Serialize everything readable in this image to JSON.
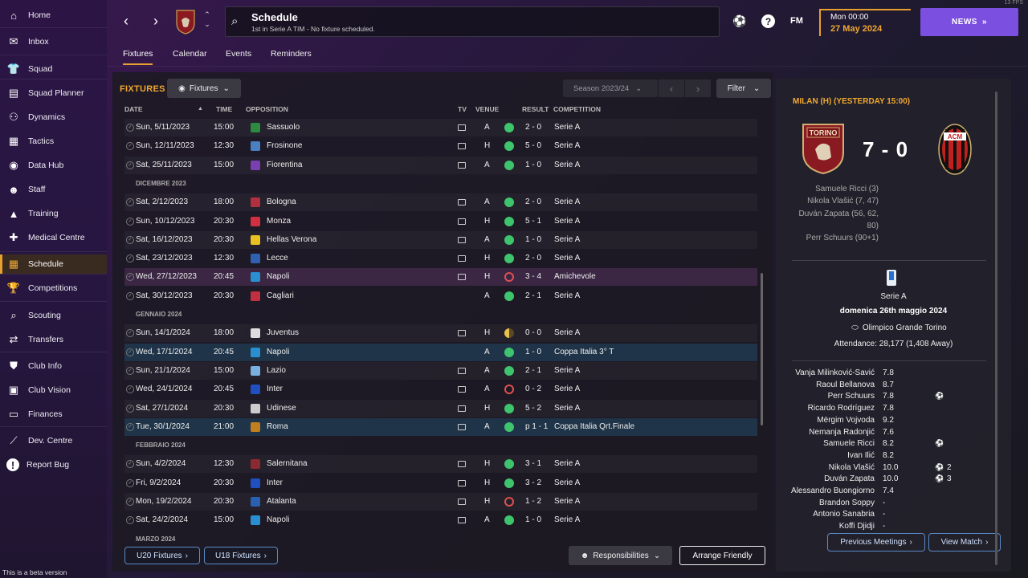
{
  "sidebar": {
    "items": [
      {
        "label": "Home",
        "icon": "home-icon",
        "glyph": "⌂"
      },
      {
        "label": "Inbox",
        "icon": "inbox-icon",
        "glyph": "✉"
      },
      {
        "label": "Squad",
        "icon": "squad-icon",
        "glyph": "👕"
      },
      {
        "label": "Squad Planner",
        "icon": "squad-planner-icon",
        "glyph": "▤"
      },
      {
        "label": "Dynamics",
        "icon": "dynamics-icon",
        "glyph": "⚇"
      },
      {
        "label": "Tactics",
        "icon": "tactics-icon",
        "glyph": "▦"
      },
      {
        "label": "Data Hub",
        "icon": "data-hub-icon",
        "glyph": "◉"
      },
      {
        "label": "Staff",
        "icon": "staff-icon",
        "glyph": "☻"
      },
      {
        "label": "Training",
        "icon": "training-icon",
        "glyph": "▲"
      },
      {
        "label": "Medical Centre",
        "icon": "medical-icon",
        "glyph": "✚"
      },
      {
        "label": "Schedule",
        "icon": "schedule-icon",
        "glyph": "▦"
      },
      {
        "label": "Competitions",
        "icon": "trophy-icon",
        "glyph": "🏆"
      },
      {
        "label": "Scouting",
        "icon": "scouting-icon",
        "glyph": "⌕"
      },
      {
        "label": "Transfers",
        "icon": "transfers-icon",
        "glyph": "⇄"
      },
      {
        "label": "Club Info",
        "icon": "club-info-icon",
        "glyph": "⛊"
      },
      {
        "label": "Club Vision",
        "icon": "club-vision-icon",
        "glyph": "▣"
      },
      {
        "label": "Finances",
        "icon": "finances-icon",
        "glyph": "▭"
      },
      {
        "label": "Dev. Centre",
        "icon": "dev-centre-icon",
        "glyph": "⟋"
      },
      {
        "label": "Report Bug",
        "icon": "report-bug-icon",
        "glyph": "!"
      }
    ],
    "beta_text": "This is a beta version"
  },
  "header": {
    "title": "Schedule",
    "subtitle": "1st in Serie A TIM - No fixture scheduled.",
    "fm_label": "FM",
    "date_time": "Mon 00:00",
    "date": "27 May 2024",
    "news_label": "NEWS",
    "fps": "13 FPS"
  },
  "tabs": [
    "Fixtures",
    "Calendar",
    "Events",
    "Reminders"
  ],
  "fixtures": {
    "title": "FIXTURES",
    "view_label": "Fixtures",
    "season_label": "Season 2023/24",
    "filter_label": "Filter",
    "columns": {
      "date": "DATE",
      "time": "TIME",
      "opposition": "OPPOSITION",
      "tv": "TV",
      "venue": "VENUE",
      "result": "RESULT",
      "competition": "COMPETITION"
    },
    "rows": [
      {
        "date": "Sun, 5/11/2023",
        "time": "15:00",
        "opp": "Sassuolo",
        "tv": true,
        "venue": "A",
        "res": "W",
        "score": "2 - 0",
        "comp": "Serie A",
        "c": "#2e8a3e"
      },
      {
        "date": "Sun, 12/11/2023",
        "time": "12:30",
        "opp": "Frosinone",
        "tv": true,
        "venue": "H",
        "res": "W",
        "score": "5 - 0",
        "comp": "Serie A",
        "c": "#4a7fc0"
      },
      {
        "date": "Sat, 25/11/2023",
        "time": "15:00",
        "opp": "Fiorentina",
        "tv": true,
        "venue": "A",
        "res": "W",
        "score": "1 - 0",
        "comp": "Serie A",
        "c": "#7a3fb0"
      },
      {
        "month": "DICEMBRE 2023"
      },
      {
        "date": "Sat, 2/12/2023",
        "time": "18:00",
        "opp": "Bologna",
        "tv": true,
        "venue": "A",
        "res": "W",
        "score": "2 - 0",
        "comp": "Serie A",
        "c": "#b03040"
      },
      {
        "date": "Sun, 10/12/2023",
        "time": "20:30",
        "opp": "Monza",
        "tv": true,
        "venue": "H",
        "res": "W",
        "score": "5 - 1",
        "comp": "Serie A",
        "c": "#d03040"
      },
      {
        "date": "Sat, 16/12/2023",
        "time": "20:30",
        "opp": "Hellas Verona",
        "tv": true,
        "venue": "A",
        "res": "W",
        "score": "1 - 0",
        "comp": "Serie A",
        "c": "#e8c020"
      },
      {
        "date": "Sat, 23/12/2023",
        "time": "12:30",
        "opp": "Lecce",
        "tv": true,
        "venue": "H",
        "res": "W",
        "score": "2 - 0",
        "comp": "Serie A",
        "c": "#3060b0"
      },
      {
        "date": "Wed, 27/12/2023",
        "time": "20:45",
        "opp": "Napoli",
        "tv": true,
        "venue": "H",
        "res": "L",
        "score": "3 - 4",
        "comp": "Amichevole",
        "c": "#2a8fd0",
        "hl": true
      },
      {
        "date": "Sat, 30/12/2023",
        "time": "20:30",
        "opp": "Cagliari",
        "tv": false,
        "venue": "A",
        "res": "W",
        "score": "2 - 1",
        "comp": "Serie A",
        "c": "#c03040"
      },
      {
        "month": "GENNAIO 2024"
      },
      {
        "date": "Sun, 14/1/2024",
        "time": "18:00",
        "opp": "Juventus",
        "tv": true,
        "venue": "H",
        "res": "D",
        "score": "0 - 0",
        "comp": "Serie A",
        "c": "#ddd"
      },
      {
        "date": "Wed, 17/1/2024",
        "time": "20:45",
        "opp": "Napoli",
        "tv": false,
        "venue": "A",
        "res": "W",
        "score": "1 - 0",
        "comp": "Coppa Italia 3° T",
        "c": "#2a8fd0",
        "sel": true
      },
      {
        "date": "Sun, 21/1/2024",
        "time": "15:00",
        "opp": "Lazio",
        "tv": true,
        "venue": "A",
        "res": "W",
        "score": "2 - 1",
        "comp": "Serie A",
        "c": "#7ab0e0"
      },
      {
        "date": "Wed, 24/1/2024",
        "time": "20:45",
        "opp": "Inter",
        "tv": true,
        "venue": "A",
        "res": "L",
        "score": "0 - 2",
        "comp": "Serie A",
        "c": "#2050c0"
      },
      {
        "date": "Sat, 27/1/2024",
        "time": "20:30",
        "opp": "Udinese",
        "tv": true,
        "venue": "H",
        "res": "W",
        "score": "5 - 2",
        "comp": "Serie A",
        "c": "#ccc"
      },
      {
        "date": "Tue, 30/1/2024",
        "time": "21:00",
        "opp": "Roma",
        "tv": true,
        "venue": "A",
        "res": "W",
        "score": "p 1 - 1",
        "comp": "Coppa Italia Qrt.Finale",
        "c": "#c08020",
        "sel": true
      },
      {
        "month": "FEBBRAIO 2024"
      },
      {
        "date": "Sun, 4/2/2024",
        "time": "12:30",
        "opp": "Salernitana",
        "tv": true,
        "venue": "H",
        "res": "W",
        "score": "3 - 1",
        "comp": "Serie A",
        "c": "#8a2a30"
      },
      {
        "date": "Fri, 9/2/2024",
        "time": "20:30",
        "opp": "Inter",
        "tv": true,
        "venue": "H",
        "res": "W",
        "score": "3 - 2",
        "comp": "Serie A",
        "c": "#2050c0"
      },
      {
        "date": "Mon, 19/2/2024",
        "time": "20:30",
        "opp": "Atalanta",
        "tv": true,
        "venue": "H",
        "res": "L",
        "score": "1 - 2",
        "comp": "Serie A",
        "c": "#2a60b0"
      },
      {
        "date": "Sat, 24/2/2024",
        "time": "15:00",
        "opp": "Napoli",
        "tv": true,
        "venue": "A",
        "res": "W",
        "score": "1 - 0",
        "comp": "Serie A",
        "c": "#2a8fd0"
      },
      {
        "month": "MARZO 2024"
      }
    ],
    "u20_label": "U20 Fixtures",
    "u18_label": "U18 Fixtures",
    "responsibilities_label": "Responsibilities",
    "arrange_label": "Arrange Friendly"
  },
  "match": {
    "title": "MILAN (H) (YESTERDAY 15:00)",
    "score": "7 - 0",
    "home_crest_text": "TORINO",
    "away_crest_text": "ACM",
    "scorers": [
      "Samuele Ricci (3)",
      "Nikola Vlašić (7, 47)",
      "Duván Zapata (56, 62,",
      "80)",
      "Perr Schuurs (90+1)"
    ],
    "competition": "Serie A",
    "date": "domenica 26th maggio 2024",
    "stadium": "Olimpico Grande Torino",
    "attendance": "Attendance: 28,177 (1,408 Away)",
    "players": [
      {
        "name": "Vanja Milinković-Savić",
        "rating": "7.8",
        "ball": false,
        "goals": ""
      },
      {
        "name": "Raoul Bellanova",
        "rating": "8.7",
        "ball": false,
        "goals": ""
      },
      {
        "name": "Perr Schuurs",
        "rating": "7.8",
        "ball": true,
        "goals": ""
      },
      {
        "name": "Ricardo Rodríguez",
        "rating": "7.8",
        "ball": false,
        "goals": ""
      },
      {
        "name": "Mërgim Vojvoda",
        "rating": "9.2",
        "ball": false,
        "goals": ""
      },
      {
        "name": "Nemanja Radonjić",
        "rating": "7.6",
        "ball": false,
        "goals": ""
      },
      {
        "name": "Samuele Ricci",
        "rating": "8.2",
        "ball": true,
        "goals": ""
      },
      {
        "name": "Ivan Ilić",
        "rating": "8.2",
        "ball": false,
        "goals": ""
      },
      {
        "name": "Nikola Vlašić",
        "rating": "10.0",
        "ball": true,
        "goals": "2"
      },
      {
        "name": "Duván Zapata",
        "rating": "10.0",
        "ball": true,
        "goals": "3"
      },
      {
        "name": "Alessandro Buongiorno",
        "rating": "7.4",
        "ball": false,
        "goals": ""
      },
      {
        "name": "Brandon Soppy",
        "rating": "-",
        "ball": false,
        "goals": ""
      },
      {
        "name": "Antonio Sanabria",
        "rating": "-",
        "ball": false,
        "goals": ""
      },
      {
        "name": "Koffi Djidji",
        "rating": "-",
        "ball": false,
        "goals": ""
      }
    ],
    "previous_label": "Previous Meetings",
    "view_label": "View Match"
  }
}
